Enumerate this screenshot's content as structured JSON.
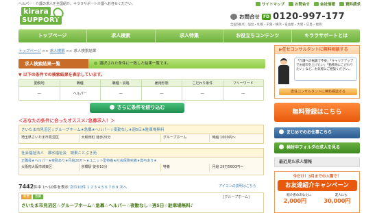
{
  "header": {
    "tagline": "ヘルパー｜介護の求人を全国紹介。キララサポート介護へお任せください。",
    "logo_line1": "kirara",
    "logo_line2": "SUPPORT",
    "top_links": [
      "サイトマップ",
      "お問合せ",
      "会社情報",
      "資料請求"
    ],
    "contact_label": "お問合せ",
    "free_dial": "FD",
    "phone": "0120-997-177",
    "area": "全国5拠点：仙台・札幌・千葉・横浜・名古屋・大阪・広島・福岡"
  },
  "nav": [
    "トップページ",
    "求人検索",
    "求人特集",
    "お役立ちコンテンツ",
    "キララサポートとは"
  ],
  "breadcrumb": {
    "items": [
      "トップページ",
      "求人検索",
      "求人検索結果"
    ],
    "sep": " >> "
  },
  "results_bar": {
    "title": "求人検索結果一覧",
    "desc": "選択された条件に一致した結果一覧です。"
  },
  "conditions": {
    "label": "▼ 以下の条件での検索結果を表示しています。",
    "headers": [
      "勤務地",
      "職種",
      "職種・資格",
      "雇用形態",
      "こだわり条件",
      "フリーワード"
    ],
    "values": [
      "―",
      "ヘルパー",
      "―",
      "―",
      "―",
      "―"
    ]
  },
  "refine_button": "さらに条件を絞り込む",
  "recommend_title": "＜あなたの条件に合ったオススメ♪急募求人！＞",
  "jobs": [
    {
      "title": "さいたま市見沼区☆グループホーム★急募★ヘルパー☆夜勤なし★週5日★駐車場無料",
      "cells": [
        "埼玉県さいたま市見沼区",
        "大和田町 徒歩20分",
        "グループホーム",
        "時給 1000円～"
      ],
      "sub": ""
    },
    {
      "title": "社会福祉法人　瀬水福祉会　城東ことぶき苑",
      "sub": "正職員★ヘルパー★夜勤あり★月給26万～★ユニット型特養★社会保険完備★賞与あり★",
      "cells": [
        "大阪府大阪市城東区",
        "京橋駅 徒歩10分",
        "特養",
        "月給 29万5600円～"
      ]
    }
  ],
  "results": {
    "count": "7442",
    "unit": "件中",
    "range": "1～10件を表示",
    "next": "次の10件",
    "pages": "1 2 3 4 5 6 7 8 9",
    "next_arrow": "次へ",
    "icon_note": "アイコンの説明はこちら"
  },
  "last_job": {
    "tags": [
      "新着",
      "急募"
    ],
    "category": "[グループホーム]",
    "title": "さいたま市見沼区☆グループホーム☆急募☆ヘルパー☆夜勤なし☆週5日☆駐車場無料♪"
  },
  "sidebar": {
    "consult_title": "▶任せコンサルタントに無料相談する",
    "consult_text": "「介護への転職で不安」「キャリアアップでお給料を上げたい」「勤務地にこだわりたい」など、お気軽にご相談ください。",
    "consult_button": "専任コンサルタントに無料相談する",
    "register": "無料登録はこちら",
    "kirara_button": "まじめでのお仕事こちら",
    "folder_button": "検討中フォルダの求人を見る",
    "viewed": "最近見た求人情報",
    "promo_top": "今だけ！3月までの入職で！",
    "promo_main": "お友達紹介キャンペーン",
    "promo_sub": [
      "紹介者のあなたに",
      "友人にも"
    ],
    "promo_amounts": [
      "2,000円",
      "30,000円"
    ]
  }
}
